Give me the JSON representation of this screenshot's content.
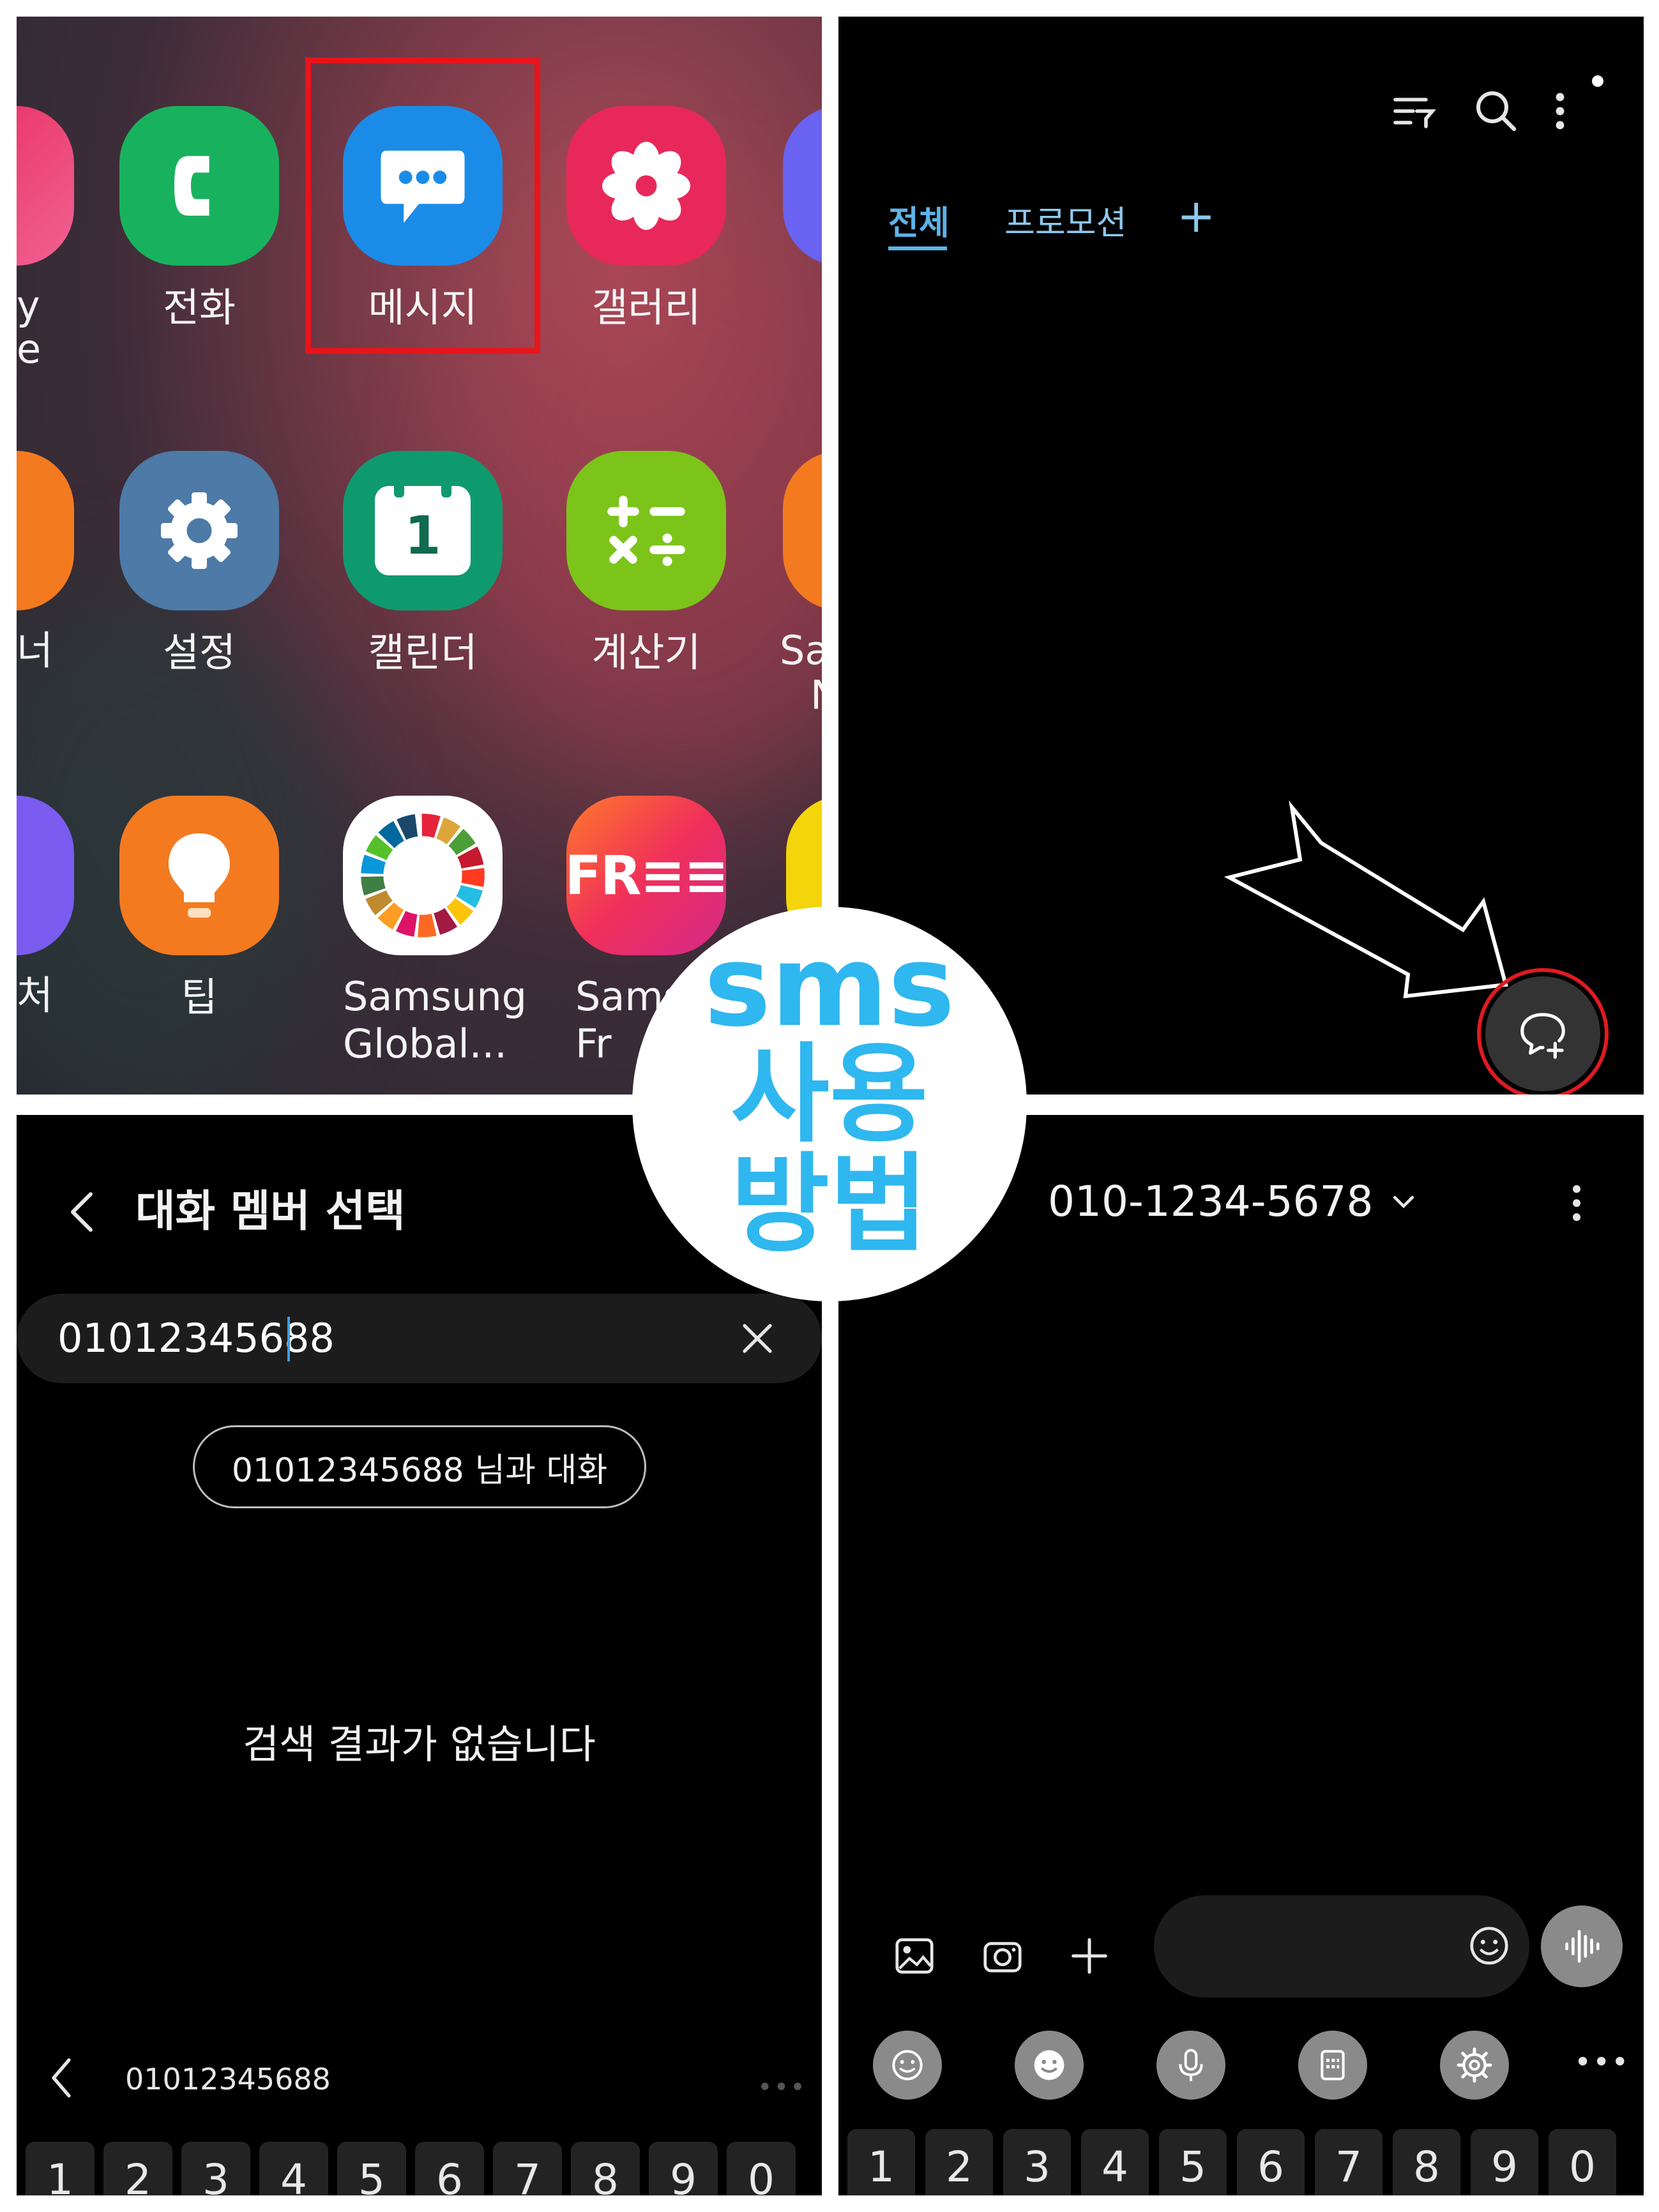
{
  "panel1": {
    "apps": [
      {
        "label": "전화",
        "icon": "phone-icon",
        "color": "#18b25e"
      },
      {
        "label": "메시지",
        "icon": "message-icon",
        "color": "#1a8ce8"
      },
      {
        "label": "갤러리",
        "icon": "flower-icon",
        "color": "#e8285a"
      },
      {
        "label": "설정",
        "icon": "gear-icon",
        "color": "#4d7aa6"
      },
      {
        "label": "캘린더",
        "icon": "calendar-icon",
        "color": "#0f9a6e",
        "icon_text": "1"
      },
      {
        "label": "계산기",
        "icon": "calculator-icon",
        "color": "#7cc41a"
      },
      {
        "label": "팁",
        "icon": "lightbulb-icon",
        "color": "#f47a20"
      },
      {
        "label": "Samsung\nGlobal...",
        "icon": "sdg-wheel-icon",
        "color": "#ffffff"
      },
      {
        "label": "Samsu\nFr",
        "icon": "free-icon",
        "color": "#f0305a",
        "icon_text": "FR≡≡"
      }
    ],
    "partial_labels": [
      "y",
      "e",
      "너",
      "처",
      "Sa",
      "N"
    ]
  },
  "panel2": {
    "tabs": [
      {
        "label": "전체",
        "active": true
      },
      {
        "label": "프로모션",
        "active": false
      },
      {
        "label": "+",
        "active": false
      }
    ],
    "toolbar_icons": [
      "filter-icon",
      "search-icon",
      "more-vert-icon"
    ],
    "fab_icon": "new-chat-icon"
  },
  "panel3": {
    "title": "대화 멤버 선택",
    "search_value": "01012345688",
    "chat_with_button": "01012345688 님과 대화",
    "empty_text": "검색 결과가 없습니다",
    "keyboard_suggestion": "01012345688",
    "number_row": [
      "1",
      "2",
      "3",
      "4",
      "5",
      "6",
      "7",
      "8",
      "9",
      "0"
    ]
  },
  "panel4": {
    "contact": "010-1234-5678",
    "number_row": [
      "1",
      "2",
      "3",
      "4",
      "5",
      "6",
      "7",
      "8",
      "9",
      "0"
    ],
    "input_icons": [
      "gallery-icon",
      "camera-icon",
      "plus-icon",
      "emoji-icon",
      "voice-icon"
    ],
    "keyboard_tools": [
      "emoji-icon",
      "sticker-icon",
      "mic-icon",
      "clipboard-icon",
      "settings-icon",
      "more-horiz-icon"
    ]
  },
  "badge": {
    "line1": "sms",
    "line2": "사용",
    "line3": "방법",
    "color": "#2fb7ef"
  },
  "colors": {
    "highlight_red": "#e8141b",
    "tab_active": "#5fb3e8",
    "tab_inactive": "#8ec8ee"
  }
}
